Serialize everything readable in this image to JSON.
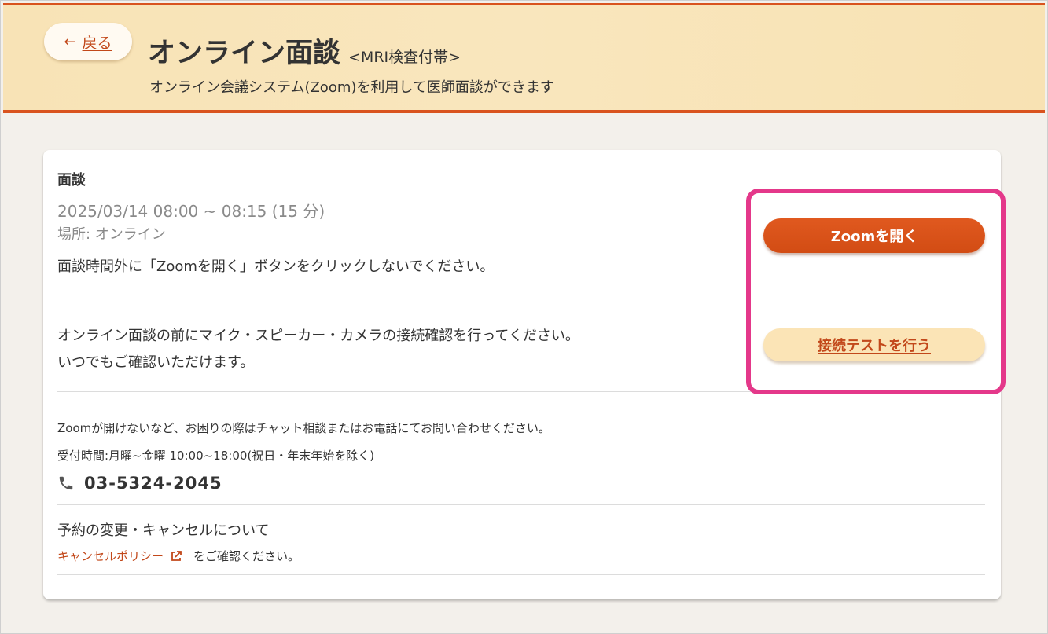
{
  "header": {
    "back_label": "戻る",
    "title": "オンライン面談",
    "title_sub": "<MRI検査付帯>",
    "description": "オンライン会議システム(Zoom)を利用して医師面談ができます"
  },
  "interview": {
    "section_label": "面談",
    "datetime": "2025/03/14 08:00 ~ 08:15 (15 分)",
    "location": "場所: オンライン",
    "warning": "面談時間外に「Zoomを開く」ボタンをクリックしないでください。",
    "zoom_button_label": "Zoomを開く"
  },
  "connection_test": {
    "line1": "オンライン面談の前にマイク・スピーカー・カメラの接続確認を行ってください。",
    "line2": "いつでもご確認いただけます。",
    "button_label": "接続テストを行う"
  },
  "support": {
    "help_text": "Zoomが開けないなど、お困りの際はチャット相談またはお電話にてお問い合わせください。",
    "hours": "受付時間:月曜~金曜 10:00~18:00(祝日・年末年始を除く)",
    "phone": "03-5324-2045"
  },
  "reservation": {
    "title": "予約の変更・キャンセルについて",
    "policy_link": "キャンセルポリシー",
    "policy_suffix": "をご確認ください。"
  },
  "colors": {
    "accent": "#d9531e",
    "highlight": "#e4388a",
    "header_bg": "#f8e3b6"
  }
}
